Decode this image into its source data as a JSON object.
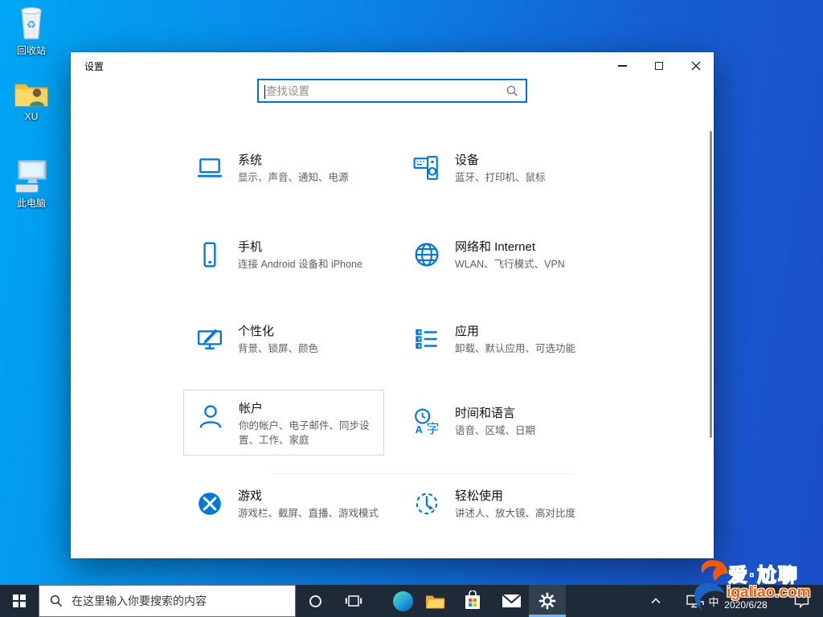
{
  "desktop": {
    "icons": [
      {
        "label": "回收站"
      },
      {
        "label": "XU"
      },
      {
        "label": "此电脑"
      }
    ]
  },
  "window": {
    "title": "设置",
    "search_placeholder": "查找设置"
  },
  "tiles": [
    {
      "title": "系统",
      "subtitle": "显示、声音、通知、电源"
    },
    {
      "title": "设备",
      "subtitle": "蓝牙、打印机、鼠标"
    },
    {
      "title": "手机",
      "subtitle": "连接 Android 设备和 iPhone"
    },
    {
      "title": "网络和 Internet",
      "subtitle": "WLAN、飞行模式、VPN"
    },
    {
      "title": "个性化",
      "subtitle": "背景、锁屏、颜色"
    },
    {
      "title": "应用",
      "subtitle": "卸载、默认应用、可选功能"
    },
    {
      "title": "帐户",
      "subtitle": "你的帐户、电子邮件、同步设置、工作、家庭"
    },
    {
      "title": "时间和语言",
      "subtitle": "语音、区域、日期"
    },
    {
      "title": "游戏",
      "subtitle": "游戏栏、截屏、直播、游戏模式"
    },
    {
      "title": "轻松使用",
      "subtitle": "讲述人、放大镜、高对比度"
    }
  ],
  "taskbar": {
    "search_placeholder": "在这里输入你要搜索的内容",
    "ime_indicator": "中",
    "date": "2020/6/28"
  },
  "watermark": {
    "title": "爱·尬聊",
    "site": "igaliao.com"
  },
  "colors": {
    "accent": "#0078d7",
    "taskbar": "#1e2a38",
    "desktop_gradient_start": "#00a6f4",
    "desktop_gradient_end": "#1b4dc8",
    "watermark_orange": "#ff5a00"
  }
}
